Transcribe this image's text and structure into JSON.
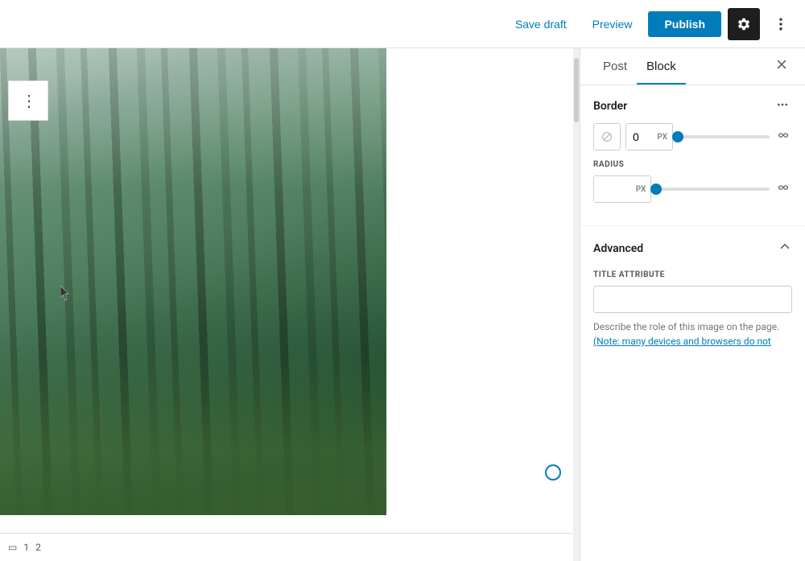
{
  "toolbar": {
    "save_draft_label": "Save draft",
    "preview_label": "Preview",
    "publish_label": "Publish",
    "settings_icon": "gear-icon",
    "more_icon": "more-options-icon"
  },
  "sidebar": {
    "tab_post_label": "Post",
    "tab_block_label": "Block",
    "active_tab": "Block",
    "close_icon": "close-icon",
    "border_section": {
      "title": "Border",
      "more_icon": "more-options-icon",
      "border_value": "0",
      "border_unit": "PX",
      "slider_position_percent": 0,
      "link_icon": "link-icon"
    },
    "radius_section": {
      "label": "RADIUS",
      "value": "",
      "unit": "PX",
      "slider_position_percent": 0,
      "link_icon": "link-icon"
    },
    "advanced_section": {
      "title": "Advanced",
      "collapse_icon": "chevron-up-icon",
      "title_attribute_label": "TITLE ATTRIBUTE",
      "title_attribute_value": "",
      "help_text": "Describe the role of this image on the page.",
      "help_link_text": "(Note: many devices and browsers do not"
    }
  },
  "editor": {
    "block_handle_dots": "⋮",
    "bottom_bar_items": [
      "□",
      "1",
      "2"
    ]
  }
}
